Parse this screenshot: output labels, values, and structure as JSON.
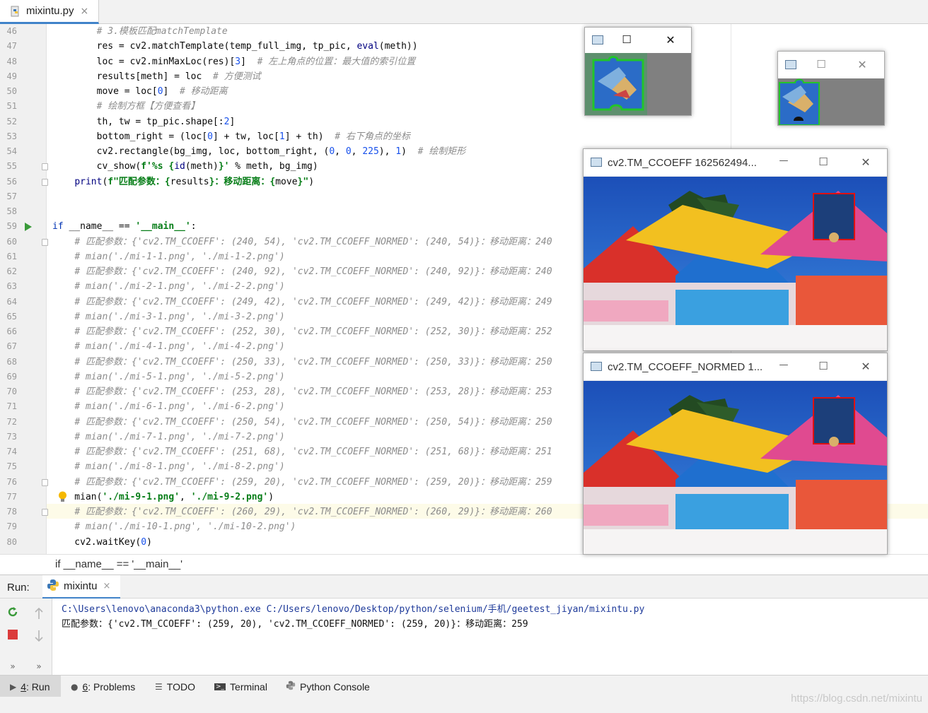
{
  "tab": {
    "filename": "mixintu.py",
    "close": "×"
  },
  "editor": {
    "lines": [
      {
        "n": "46",
        "segs": [
          {
            "t": "        "
          },
          {
            "t": "# 3.模板匹配matchTemplate",
            "c": "cm"
          }
        ]
      },
      {
        "n": "47",
        "segs": [
          {
            "t": "        res = cv2.matchTemplate(temp_full_img, tp_pic, "
          },
          {
            "t": "eval",
            "c": "bi"
          },
          {
            "t": "(meth))"
          }
        ]
      },
      {
        "n": "48",
        "segs": [
          {
            "t": "        loc = cv2.minMaxLoc(res)["
          },
          {
            "t": "3",
            "c": "num"
          },
          {
            "t": "]  "
          },
          {
            "t": "# 左上角点的位置：最大值的索引位置",
            "c": "cm"
          }
        ]
      },
      {
        "n": "49",
        "segs": [
          {
            "t": "        results[meth] = loc  "
          },
          {
            "t": "# 方便测试",
            "c": "cm"
          }
        ]
      },
      {
        "n": "50",
        "segs": [
          {
            "t": "        move = loc["
          },
          {
            "t": "0",
            "c": "num"
          },
          {
            "t": "]  "
          },
          {
            "t": "# 移动距离",
            "c": "cm"
          }
        ]
      },
      {
        "n": "51",
        "segs": [
          {
            "t": "        "
          },
          {
            "t": "# 绘制方框【方便查看】",
            "c": "cm"
          }
        ]
      },
      {
        "n": "52",
        "segs": [
          {
            "t": "        th, tw = tp_pic.shape[:"
          },
          {
            "t": "2",
            "c": "num"
          },
          {
            "t": "]"
          }
        ]
      },
      {
        "n": "53",
        "segs": [
          {
            "t": "        bottom_right = (loc["
          },
          {
            "t": "0",
            "c": "num"
          },
          {
            "t": "] + tw, loc["
          },
          {
            "t": "1",
            "c": "num"
          },
          {
            "t": "] + th)  "
          },
          {
            "t": "# 右下角点的坐标",
            "c": "cm"
          }
        ]
      },
      {
        "n": "54",
        "segs": [
          {
            "t": "        cv2.rectangle(bg_img, loc, bottom_right, ("
          },
          {
            "t": "0",
            "c": "num"
          },
          {
            "t": ", "
          },
          {
            "t": "0",
            "c": "num"
          },
          {
            "t": ", "
          },
          {
            "t": "225",
            "c": "num"
          },
          {
            "t": "), "
          },
          {
            "t": "1",
            "c": "num"
          },
          {
            "t": ")  "
          },
          {
            "t": "# 绘制矩形",
            "c": "cm"
          }
        ]
      },
      {
        "n": "55",
        "segs": [
          {
            "t": "        cv_show("
          },
          {
            "t": "f'%s {",
            "c": "st"
          },
          {
            "t": "id",
            "c": "bi"
          },
          {
            "t": "(meth)"
          },
          {
            "t": "}'",
            "c": "st"
          },
          {
            "t": " % meth, bg_img)"
          }
        ]
      },
      {
        "n": "56",
        "segs": [
          {
            "t": "    "
          },
          {
            "t": "print",
            "c": "bi"
          },
          {
            "t": "(",
            "c": ""
          },
          {
            "t": "f\"匹配参数：{",
            "c": "st"
          },
          {
            "t": "results"
          },
          {
            "t": "}：移动距离：{",
            "c": "st"
          },
          {
            "t": "move"
          },
          {
            "t": "}\"",
            "c": "st"
          },
          {
            "t": ")"
          }
        ]
      },
      {
        "n": "57",
        "segs": []
      },
      {
        "n": "58",
        "segs": []
      },
      {
        "n": "59",
        "segs": [
          {
            "t": "if",
            "c": "kw"
          },
          {
            "t": " __name__ == "
          },
          {
            "t": "'__main__'",
            "c": "st"
          },
          {
            "t": ":"
          }
        ]
      },
      {
        "n": "60",
        "segs": [
          {
            "t": "    "
          },
          {
            "t": "# 匹配参数：{'cv2.TM_CCOEFF': (240, 54), 'cv2.TM_CCOEFF_NORMED': (240, 54)}：移动距离：240",
            "c": "cm"
          }
        ]
      },
      {
        "n": "61",
        "segs": [
          {
            "t": "    "
          },
          {
            "t": "# mian('./mi-1-1.png', './mi-1-2.png')",
            "c": "cm"
          }
        ]
      },
      {
        "n": "62",
        "segs": [
          {
            "t": "    "
          },
          {
            "t": "# 匹配参数：{'cv2.TM_CCOEFF': (240, 92), 'cv2.TM_CCOEFF_NORMED': (240, 92)}：移动距离：240",
            "c": "cm"
          }
        ]
      },
      {
        "n": "63",
        "segs": [
          {
            "t": "    "
          },
          {
            "t": "# mian('./mi-2-1.png', './mi-2-2.png')",
            "c": "cm"
          }
        ]
      },
      {
        "n": "64",
        "segs": [
          {
            "t": "    "
          },
          {
            "t": "# 匹配参数：{'cv2.TM_CCOEFF': (249, 42), 'cv2.TM_CCOEFF_NORMED': (249, 42)}：移动距离：249",
            "c": "cm"
          }
        ]
      },
      {
        "n": "65",
        "segs": [
          {
            "t": "    "
          },
          {
            "t": "# mian('./mi-3-1.png', './mi-3-2.png')",
            "c": "cm"
          }
        ]
      },
      {
        "n": "66",
        "segs": [
          {
            "t": "    "
          },
          {
            "t": "# 匹配参数：{'cv2.TM_CCOEFF': (252, 30), 'cv2.TM_CCOEFF_NORMED': (252, 30)}：移动距离：252",
            "c": "cm"
          }
        ]
      },
      {
        "n": "67",
        "segs": [
          {
            "t": "    "
          },
          {
            "t": "# mian('./mi-4-1.png', './mi-4-2.png')",
            "c": "cm"
          }
        ]
      },
      {
        "n": "68",
        "segs": [
          {
            "t": "    "
          },
          {
            "t": "# 匹配参数：{'cv2.TM_CCOEFF': (250, 33), 'cv2.TM_CCOEFF_NORMED': (250, 33)}：移动距离：250",
            "c": "cm"
          }
        ]
      },
      {
        "n": "69",
        "segs": [
          {
            "t": "    "
          },
          {
            "t": "# mian('./mi-5-1.png', './mi-5-2.png')",
            "c": "cm"
          }
        ]
      },
      {
        "n": "70",
        "segs": [
          {
            "t": "    "
          },
          {
            "t": "# 匹配参数：{'cv2.TM_CCOEFF': (253, 28), 'cv2.TM_CCOEFF_NORMED': (253, 28)}：移动距离：253",
            "c": "cm"
          }
        ]
      },
      {
        "n": "71",
        "segs": [
          {
            "t": "    "
          },
          {
            "t": "# mian('./mi-6-1.png', './mi-6-2.png')",
            "c": "cm"
          }
        ]
      },
      {
        "n": "72",
        "segs": [
          {
            "t": "    "
          },
          {
            "t": "# 匹配参数：{'cv2.TM_CCOEFF': (250, 54), 'cv2.TM_CCOEFF_NORMED': (250, 54)}：移动距离：250",
            "c": "cm"
          }
        ]
      },
      {
        "n": "73",
        "segs": [
          {
            "t": "    "
          },
          {
            "t": "# mian('./mi-7-1.png', './mi-7-2.png')",
            "c": "cm"
          }
        ]
      },
      {
        "n": "74",
        "segs": [
          {
            "t": "    "
          },
          {
            "t": "# 匹配参数：{'cv2.TM_CCOEFF': (251, 68), 'cv2.TM_CCOEFF_NORMED': (251, 68)}：移动距离：251",
            "c": "cm"
          }
        ]
      },
      {
        "n": "75",
        "segs": [
          {
            "t": "    "
          },
          {
            "t": "# mian('./mi-8-1.png', './mi-8-2.png')",
            "c": "cm"
          }
        ]
      },
      {
        "n": "76",
        "segs": [
          {
            "t": "    "
          },
          {
            "t": "# 匹配参数：{'cv2.TM_CCOEFF': (259, 20), 'cv2.TM_CCOEFF_NORMED': (259, 20)}：移动距离：259",
            "c": "cm"
          }
        ]
      },
      {
        "n": "77",
        "segs": [
          {
            "t": "    mian("
          },
          {
            "t": "'./mi-9-1.png'",
            "c": "st"
          },
          {
            "t": ", "
          },
          {
            "t": "'./mi-9-2.png'",
            "c": "st"
          },
          {
            "t": ")"
          }
        ]
      },
      {
        "n": "78",
        "segs": [
          {
            "t": "    "
          },
          {
            "t": "# 匹配参数：{'cv2.TM_CCOEFF': (260, 29), 'cv2.TM_CCOEFF_NORMED': (260, 29)}：移动距离：260",
            "c": "cm"
          }
        ]
      },
      {
        "n": "79",
        "segs": [
          {
            "t": "    "
          },
          {
            "t": "# mian('./mi-10-1.png', './mi-10-2.png')",
            "c": "cm"
          }
        ]
      },
      {
        "n": "80",
        "segs": [
          {
            "t": "    cv2.waitKey("
          },
          {
            "t": "0",
            "c": "num"
          },
          {
            "t": ")"
          }
        ]
      }
    ]
  },
  "breadcrumb": "if __name__ == '__main__'",
  "run": {
    "label": "Run:",
    "tab": "mixintu",
    "close": "×",
    "console_cmd": "C:\\Users\\lenovo\\anaconda3\\python.exe C:/Users/lenovo/Desktop/python/selenium/手机/geetest_jiyan/mixintu.py",
    "console_out": "匹配参数：{'cv2.TM_CCOEFF': (259, 20), 'cv2.TM_CCOEFF_NORMED': (259, 20)}：移动距离：259",
    "more": "»"
  },
  "statusbar": [
    {
      "key": "run",
      "num": "4",
      "label": ": Run"
    },
    {
      "key": "problems",
      "num": "6",
      "label": ": Problems"
    },
    {
      "key": "todo",
      "num": "",
      "label": "TODO"
    },
    {
      "key": "terminal",
      "num": "",
      "label": "Terminal"
    },
    {
      "key": "pyconsole",
      "num": "",
      "label": "Python Console"
    }
  ],
  "windows": {
    "ccoeff_title": "cv2.TM_CCOEFF 162562494...",
    "normed_title": "cv2.TM_CCOEFF_NORMED 1...",
    "minimize": "—",
    "maximize": "☐",
    "close": "✕"
  },
  "watermark": "https://blog.csdn.net/mixintu",
  "colors": {
    "accent": "#4083c9",
    "comment": "#8c8c8c",
    "keyword": "#0033b3",
    "string": "#067d17",
    "number": "#1750eb"
  }
}
